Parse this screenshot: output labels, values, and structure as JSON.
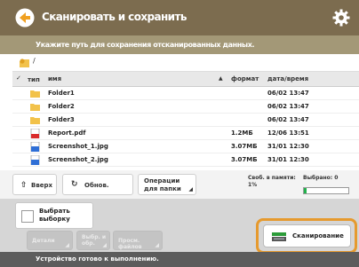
{
  "app": {
    "title": "Сканировать и сохранить",
    "logo_icon": "arrow-logo-icon",
    "settings_icon": "gear-icon"
  },
  "instruction": "Укажите путь для сохранения отсканированных данных.",
  "path": {
    "icon": "folder-key-icon",
    "text": "/"
  },
  "header": {
    "check_label": "✓",
    "type_label": "тип",
    "name_label": "имя",
    "sort_indicator": "▲",
    "size_label": "формат",
    "date_label": "дата/время"
  },
  "files": [
    {
      "type": "folder",
      "name": "Folder1",
      "size": "",
      "date": "06/02 13:47"
    },
    {
      "type": "folder",
      "name": "Folder2",
      "size": "",
      "date": "06/02 13:47"
    },
    {
      "type": "folder",
      "name": "Folder3",
      "size": "",
      "date": "06/02 13:47"
    },
    {
      "type": "pdf",
      "name": "Report.pdf",
      "size": "1.2МБ",
      "date": "12/06 13:51"
    },
    {
      "type": "image",
      "name": "Screenshot_1.jpg",
      "size": "3.07МБ",
      "date": "31/01 12:30"
    },
    {
      "type": "image",
      "name": "Screenshot_2.jpg",
      "size": "3.07МБ",
      "date": "31/01 12:30"
    }
  ],
  "toolbar": {
    "up_label": "Вверх",
    "up_icon": "up-arrow-icon",
    "refresh_label": "Обнов.",
    "refresh_icon": "refresh-icon",
    "ops_label": "Операции для папки",
    "memory_label": "Своб. в памяти: 1%",
    "selected_label": "Выбрано: 0",
    "memory_percent": 5
  },
  "bottom": {
    "select_label": "Выбрать выборку",
    "btn1_label": "Детали",
    "btn2_label": "Выбр. и обр.",
    "btn3_label": "Просм. файлов",
    "scan_label": "Сканирование",
    "scan_icon": "scanner-icon"
  },
  "status": "Устройство готово к выполнению.",
  "colors": {
    "titlebar": "#7c6c4f",
    "instruction_bar": "#a39877",
    "highlight": "#e69a2e",
    "memory_fill": "#22b14c"
  }
}
